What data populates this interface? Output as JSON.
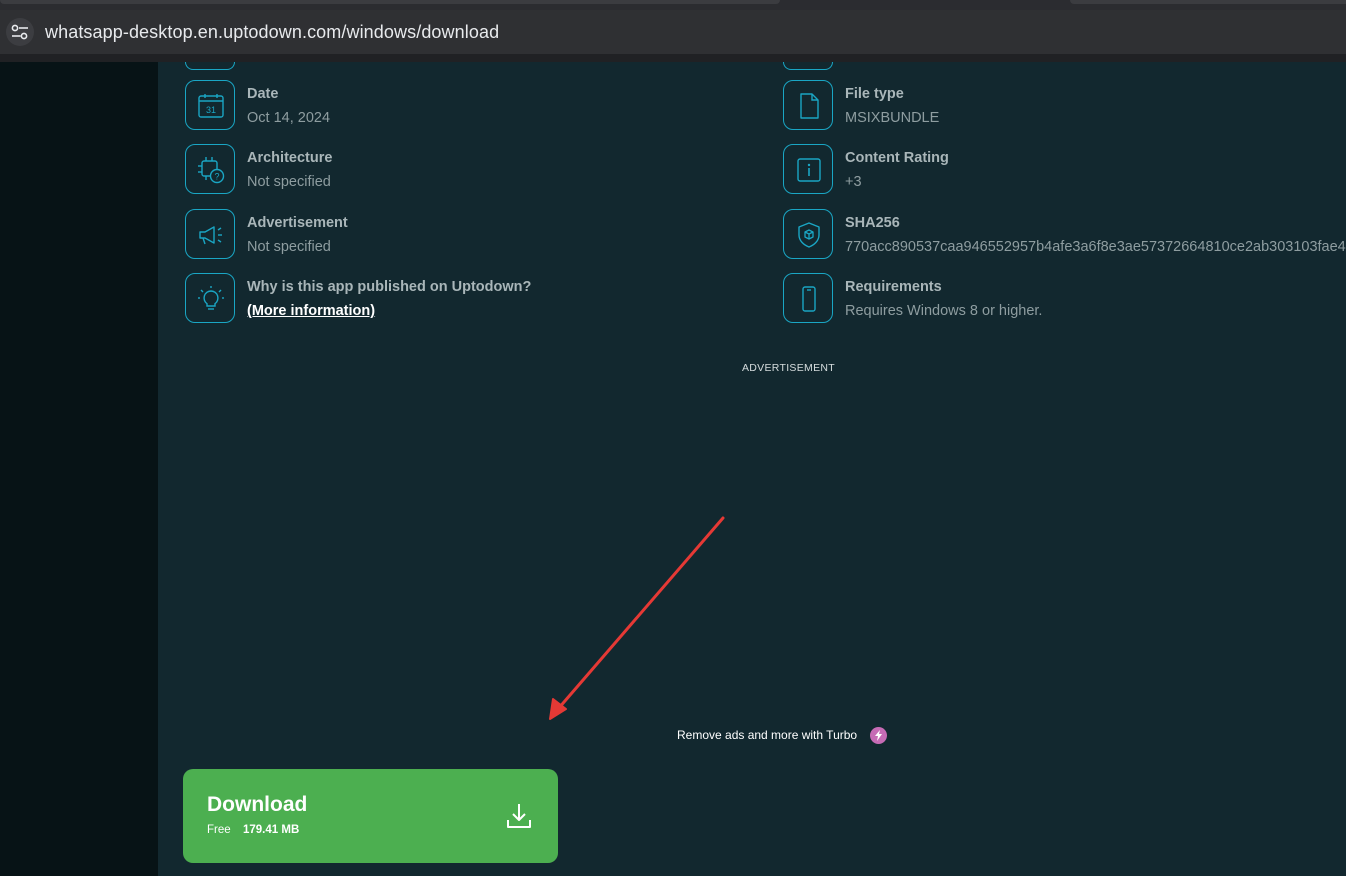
{
  "browser": {
    "url": "whatsapp-desktop.en.uptodown.com/windows/download",
    "site_icon": "tune-icon"
  },
  "details": {
    "left": [
      {
        "label": "Date",
        "value": "Oct 14, 2024",
        "icon": "calendar-icon"
      },
      {
        "label": "Architecture",
        "value": "Not specified",
        "icon": "chip-question-icon"
      },
      {
        "label": "Advertisement",
        "value": "Not specified",
        "icon": "megaphone-icon"
      },
      {
        "label": "Why is this app published on Uptodown?",
        "value": "(More information)",
        "icon": "lightbulb-icon"
      }
    ],
    "right": [
      {
        "label": "File type",
        "value": "MSIXBUNDLE",
        "icon": "file-icon"
      },
      {
        "label": "Content Rating",
        "value": "+3",
        "icon": "info-icon"
      },
      {
        "label": "SHA256",
        "value": "770acc890537caa946552957b4afe3a6f8e3ae57372664810ce2ab303103fae4",
        "icon": "shield-box-icon"
      },
      {
        "label": "Requirements",
        "value": "Requires Windows 8 or higher.",
        "icon": "phone-icon"
      }
    ]
  },
  "ad": {
    "label": "ADVERTISEMENT",
    "turbo_text": "Remove ads and more with Turbo"
  },
  "download": {
    "title": "Download",
    "price": "Free",
    "size": "179.41 MB"
  },
  "colors": {
    "accent": "#1aa6c4",
    "download_green": "#4caf50",
    "arrow_red": "#e53935",
    "turbo_pink": "#c66bb5"
  }
}
